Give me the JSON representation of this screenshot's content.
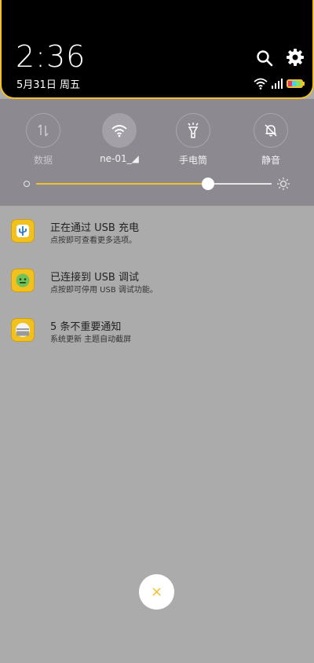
{
  "header": {
    "time": "2:36",
    "date": "5月31日 周五"
  },
  "quick_settings": {
    "tiles": [
      {
        "label": "数据",
        "icon": "data-arrows-icon",
        "active": false
      },
      {
        "label": "ne-01_◢",
        "icon": "wifi-icon",
        "active": true
      },
      {
        "label": "手电筒",
        "icon": "flashlight-icon",
        "active": false
      },
      {
        "label": "静音",
        "icon": "bell-off-icon",
        "active": false
      }
    ],
    "brightness": 0.73
  },
  "notifications": [
    {
      "title": "正在通过 USB 充电",
      "subtitle": "点按即可查看更多选项。",
      "icon": "usb-icon"
    },
    {
      "title": "已连接到 USB 调试",
      "subtitle": "点按即可停用 USB 调试功能。",
      "icon": "android-icon"
    },
    {
      "title": "5 条不重要通知",
      "subtitle": "系统更新 主题自动截屏",
      "icon": "collapsed-notifications-icon"
    }
  ],
  "close_button": {
    "label": "×"
  },
  "colors": {
    "accent": "#f3c02b",
    "panel": "#8c8a90",
    "background": "#ababab"
  }
}
